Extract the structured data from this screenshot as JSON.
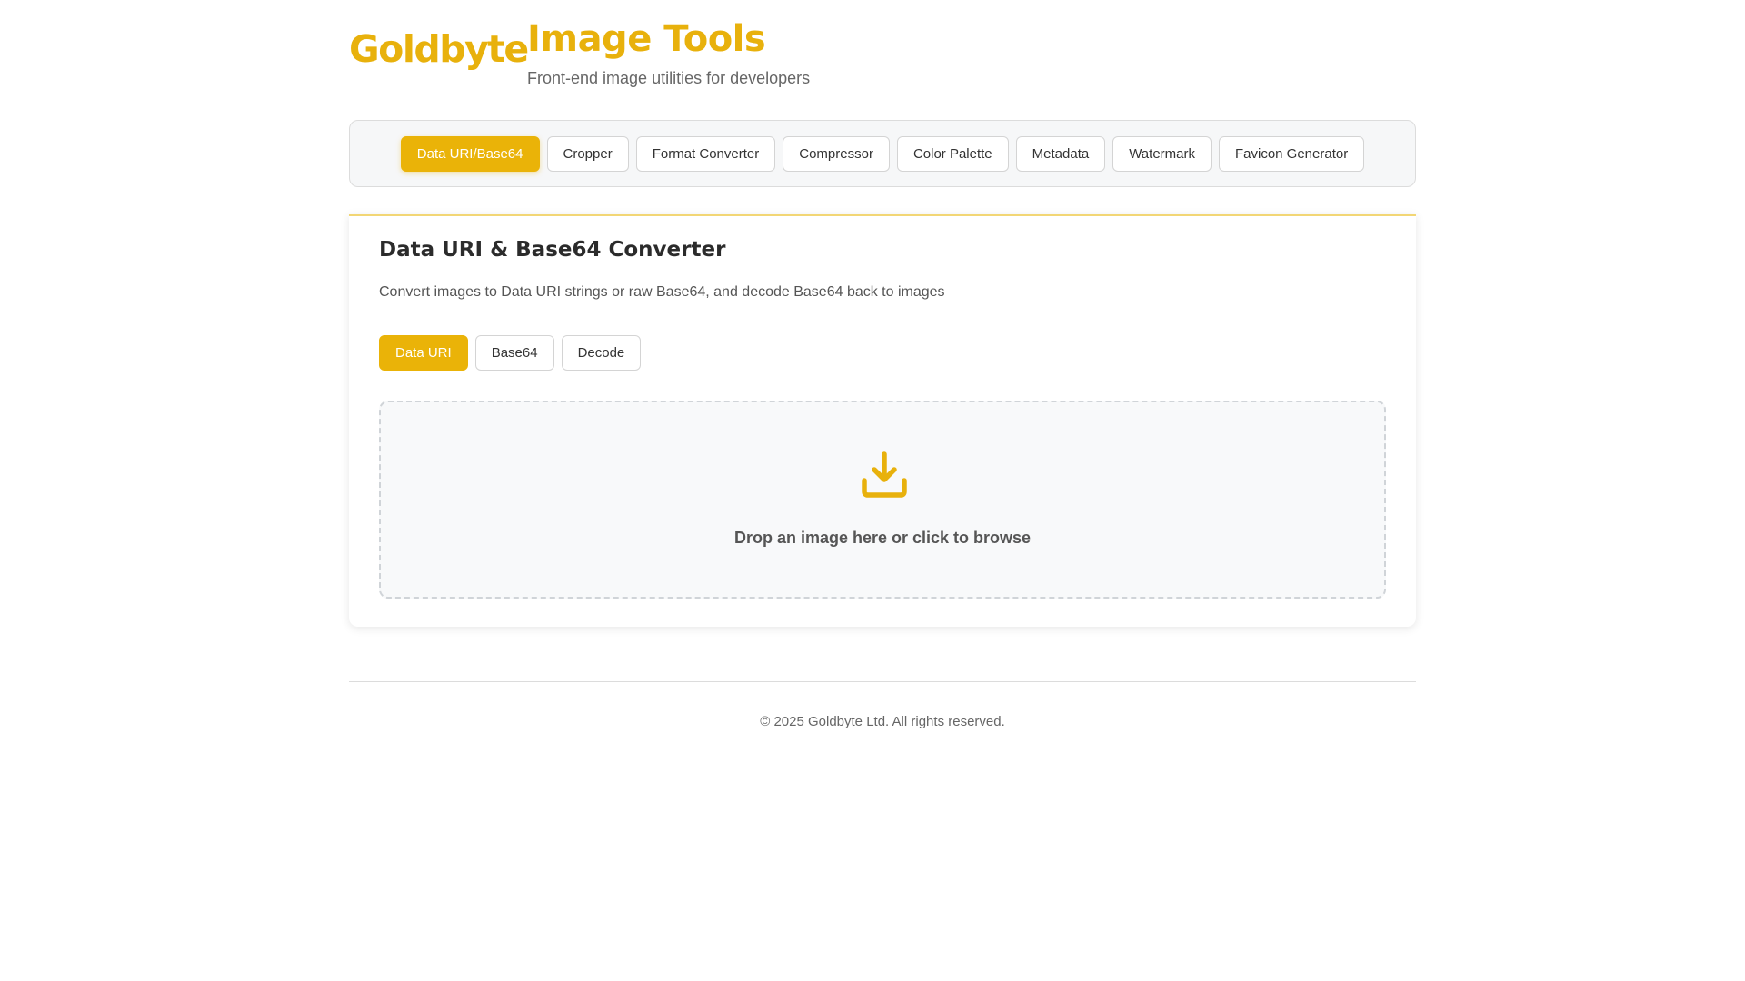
{
  "brand": {
    "logo_text": "Goldbyte",
    "accent_color": "#eab308"
  },
  "header": {
    "title": "Image Tools",
    "subtitle": "Front-end image utilities for developers"
  },
  "tool_nav": {
    "active_index": 0,
    "items": [
      {
        "label": "Data URI/Base64"
      },
      {
        "label": "Cropper"
      },
      {
        "label": "Format Converter"
      },
      {
        "label": "Compressor"
      },
      {
        "label": "Color Palette"
      },
      {
        "label": "Metadata"
      },
      {
        "label": "Watermark"
      },
      {
        "label": "Favicon Generator"
      }
    ]
  },
  "card": {
    "title": "Data URI & Base64 Converter",
    "description": "Convert images to Data URI strings or raw Base64, and decode Base64 back to images",
    "active_tab_index": 0,
    "tabs": [
      {
        "label": "Data URI"
      },
      {
        "label": "Base64"
      },
      {
        "label": "Decode"
      }
    ],
    "dropzone": {
      "icon": "download-icon",
      "text": "Drop an image here or click to browse"
    }
  },
  "footer": {
    "copyright": "© 2025 Goldbyte Ltd. All rights reserved."
  }
}
